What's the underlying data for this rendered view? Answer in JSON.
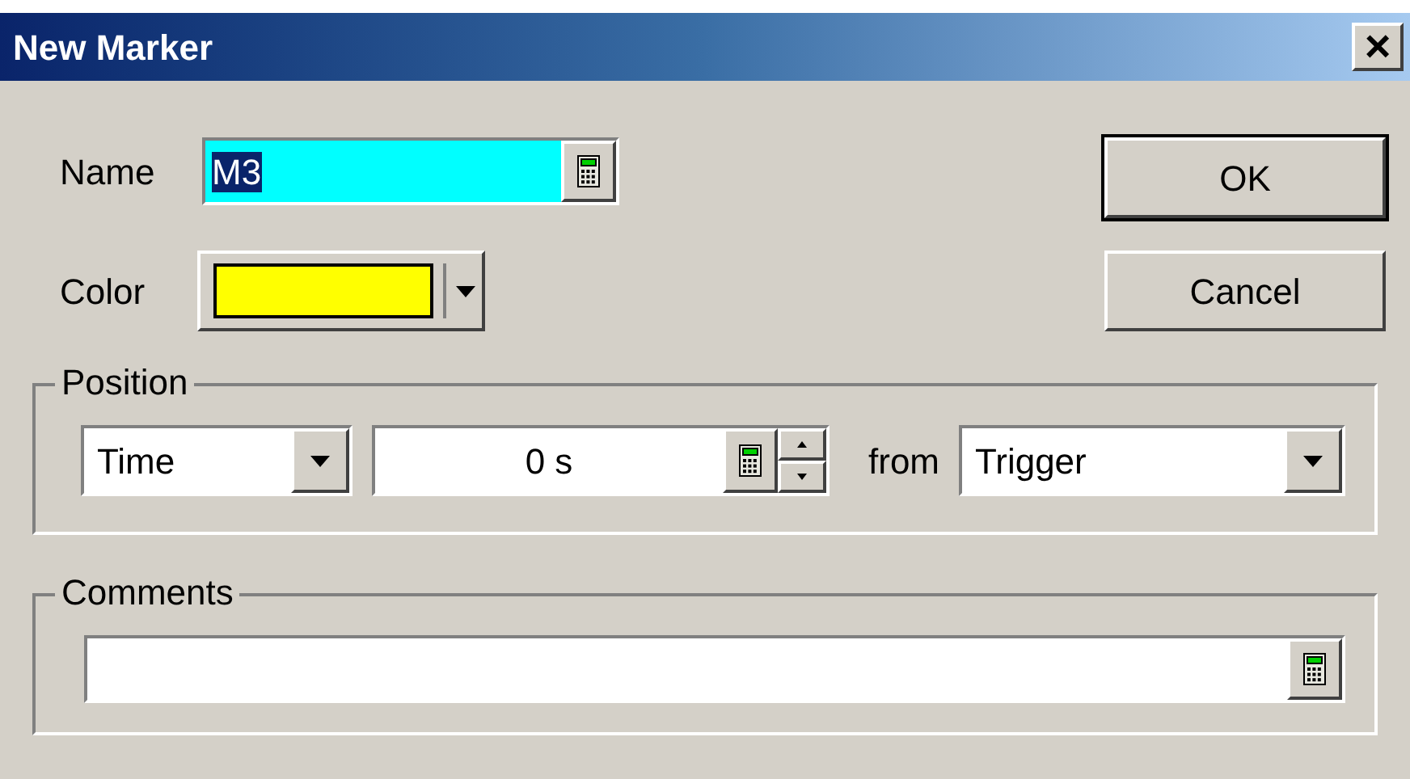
{
  "window": {
    "title": "New Marker",
    "close": "×"
  },
  "name": {
    "label": "Name",
    "value": "M3",
    "selected": true
  },
  "color": {
    "label": "Color",
    "color": "#ffff00"
  },
  "buttons": [
    {
      "label": "OK",
      "default": true
    },
    {
      "label": "Cancel",
      "default": false
    }
  ],
  "position": {
    "title": "Position",
    "mode": "Time",
    "value": "0 s",
    "from_label": "from",
    "reference": "Trigger"
  },
  "comments": {
    "title": "Comments"
  }
}
